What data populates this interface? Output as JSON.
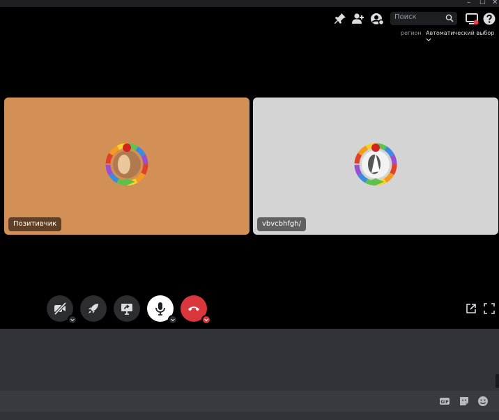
{
  "window": {
    "minimize": "–",
    "maximize": "☐",
    "close": "✕"
  },
  "topbar": {
    "search_placeholder": "Поиск",
    "icons": [
      "pin-icon",
      "add-member-icon",
      "threads-icon",
      "inbox-icon",
      "help-icon"
    ]
  },
  "region": {
    "label": "регион",
    "value": "Автоматический выбор"
  },
  "participants": [
    {
      "name": "Позитивчик",
      "tile_color": "#d28f56"
    },
    {
      "name": "vbvcbhfgh/",
      "tile_color": "#d4d4d4"
    }
  ],
  "controls": [
    "camera-off",
    "activity",
    "screen-share",
    "microphone",
    "disconnect"
  ],
  "colors": {
    "disconnect": "#da373c",
    "accent": "#5865f2"
  },
  "chat_input": {
    "icons": [
      "gif-icon",
      "sticker-icon",
      "emoji-icon"
    ]
  }
}
